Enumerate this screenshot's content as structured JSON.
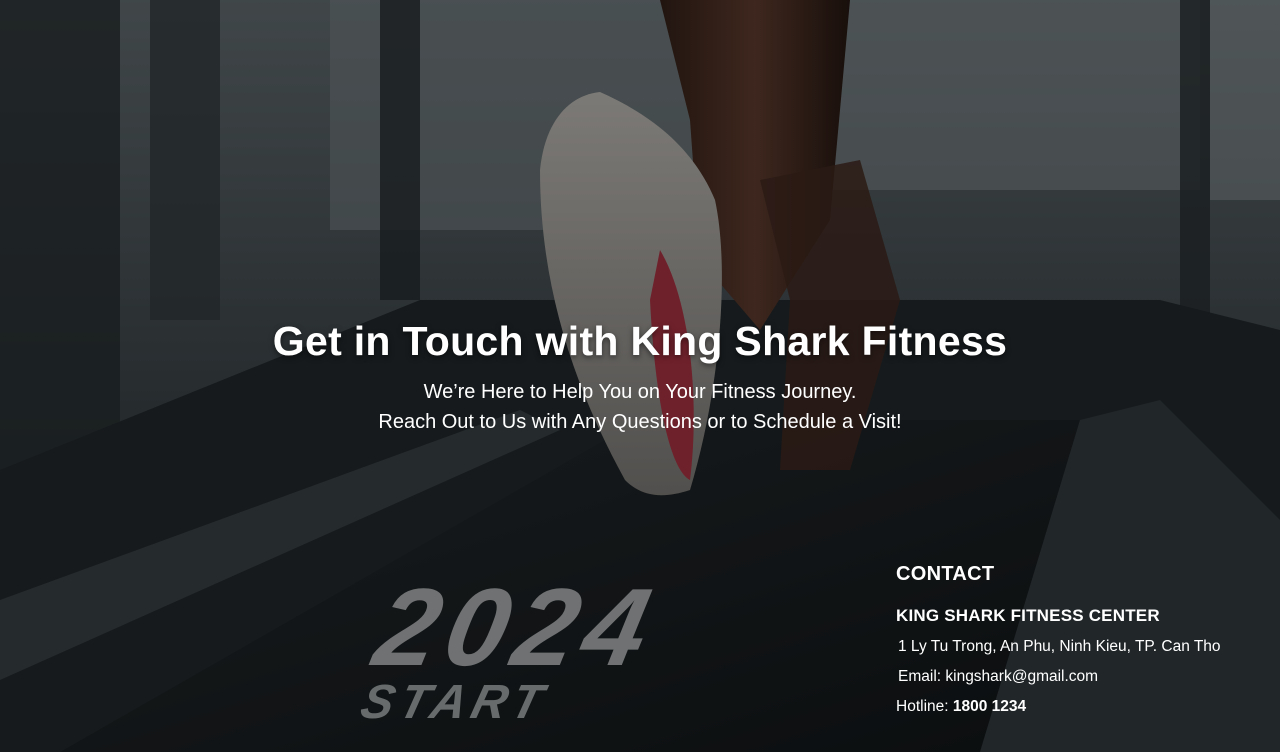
{
  "hero": {
    "title": "Get in Touch with King Shark Fitness",
    "subtitle_line1": "We’re Here to Help You on Your Fitness Journey.",
    "subtitle_line2": "Reach Out to Us with Any Questions or to Schedule a Visit!"
  },
  "background": {
    "treadmill_number": "2024",
    "treadmill_word": "START"
  },
  "contact": {
    "heading": "CONTACT",
    "company": "KING SHARK FITNESS CENTER",
    "address": "1 Ly Tu Trong, An Phu, Ninh Kieu, TP. Can Tho",
    "email_label": "Email: ",
    "email": "kingshark@gmail.com",
    "hotline_label": "Hotline: ",
    "hotline": "1800 1234"
  }
}
